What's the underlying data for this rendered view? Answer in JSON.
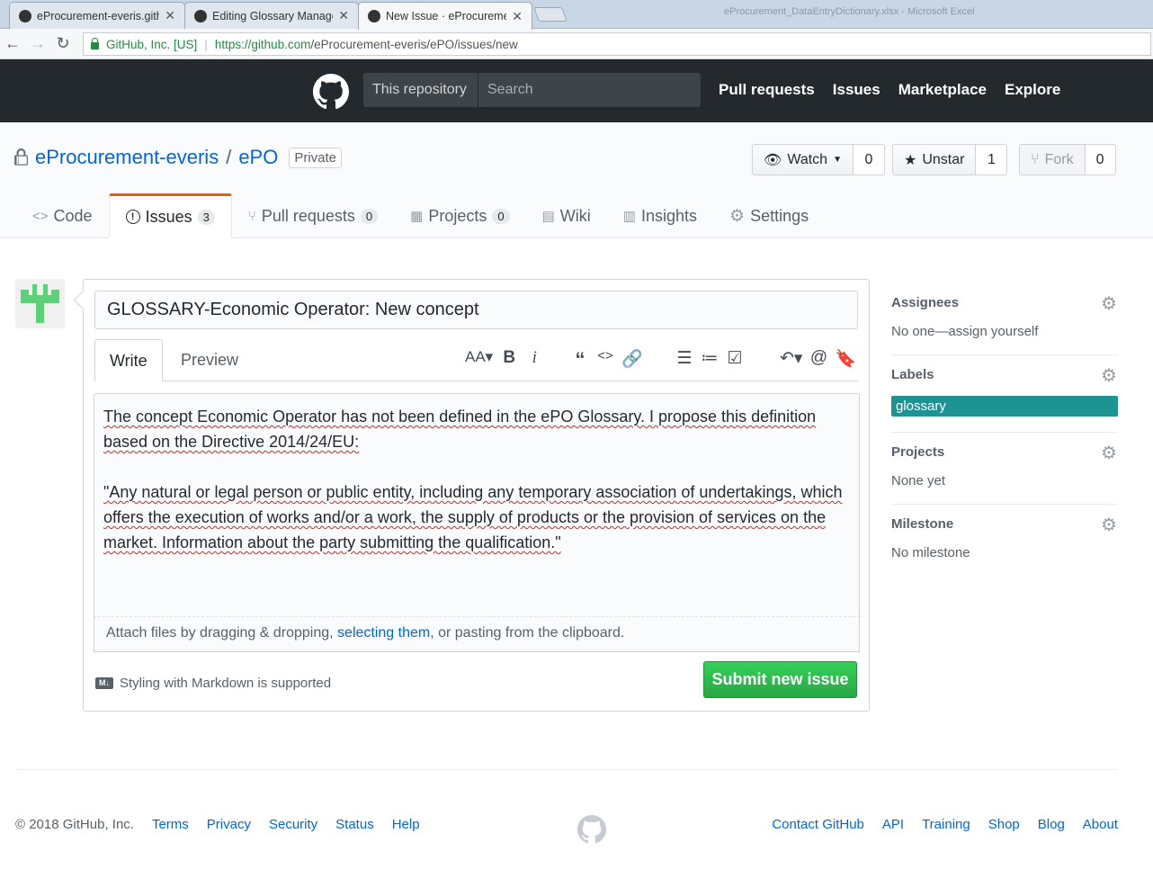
{
  "browser": {
    "tabs": [
      {
        "title": "eProcurement-everis.gith"
      },
      {
        "title": "Editing Glossary Manage"
      },
      {
        "title": "New Issue · eProcuremen"
      }
    ],
    "window_hint": "eProcurement_DataEntryDictionary.xlsx - Microsoft Excel",
    "secure_label": "GitHub, Inc. [US]",
    "url_host": "https://github.com",
    "url_path": "/eProcurement-everis/ePO/issues/new"
  },
  "header": {
    "scope": "This repository",
    "search_placeholder": "Search",
    "nav": [
      "Pull requests",
      "Issues",
      "Marketplace",
      "Explore"
    ]
  },
  "repo": {
    "owner": "eProcurement-everis",
    "slash": "/",
    "name": "ePO",
    "visibility": "Private",
    "watch": {
      "label": "Watch",
      "count": "0"
    },
    "star": {
      "label": "Unstar",
      "count": "1"
    },
    "fork": {
      "label": "Fork",
      "count": "0"
    },
    "tabs": [
      {
        "label": "Code",
        "icon": "<>"
      },
      {
        "label": "Issues",
        "count": "3",
        "icon": "!"
      },
      {
        "label": "Pull requests",
        "count": "0",
        "icon": "⑂"
      },
      {
        "label": "Projects",
        "count": "0",
        "icon": "▦"
      },
      {
        "label": "Wiki",
        "icon": "▤"
      },
      {
        "label": "Insights",
        "icon": "▥"
      },
      {
        "label": "Settings",
        "icon": "⚙"
      }
    ]
  },
  "issue": {
    "title": "GLOSSARY-Economic Operator: New concept",
    "write_tab": "Write",
    "preview_tab": "Preview",
    "body_p1": "The concept Economic Operator has not been defined in the ePO Glossary. I propose this definition based on the Directive 2014/24/EU:",
    "body_p2": "\"Any natural or legal person or public entity, including any temporary association of undertakings, which offers the execution of works and/or a work, the supply of products or the provision of services on the market. Information about the party submitting the qualification.\"",
    "attach_pre": "Attach files by dragging & dropping, ",
    "attach_link": "selecting them",
    "attach_post": ", or pasting from the clipboard.",
    "md_logo": "M↓",
    "markdown_hint": "Styling with Markdown is supported",
    "submit": "Submit new issue"
  },
  "sidebar": {
    "assignees": {
      "heading": "Assignees",
      "value": "No one—assign yourself"
    },
    "labels": {
      "heading": "Labels",
      "value": "glossary"
    },
    "projects": {
      "heading": "Projects",
      "value": "None yet"
    },
    "milestone": {
      "heading": "Milestone",
      "value": "No milestone"
    }
  },
  "footer": {
    "copyright": "© 2018 GitHub, Inc.",
    "left_links": [
      "Terms",
      "Privacy",
      "Security",
      "Status",
      "Help"
    ],
    "right_links": [
      "Contact GitHub",
      "API",
      "Training",
      "Shop",
      "Blog",
      "About"
    ]
  },
  "colors": {
    "header_bg": "#24292e",
    "link": "#0366d6",
    "submit": "#28a745",
    "label_glossary": "#1d9394",
    "tab_accent": "#e36209"
  }
}
